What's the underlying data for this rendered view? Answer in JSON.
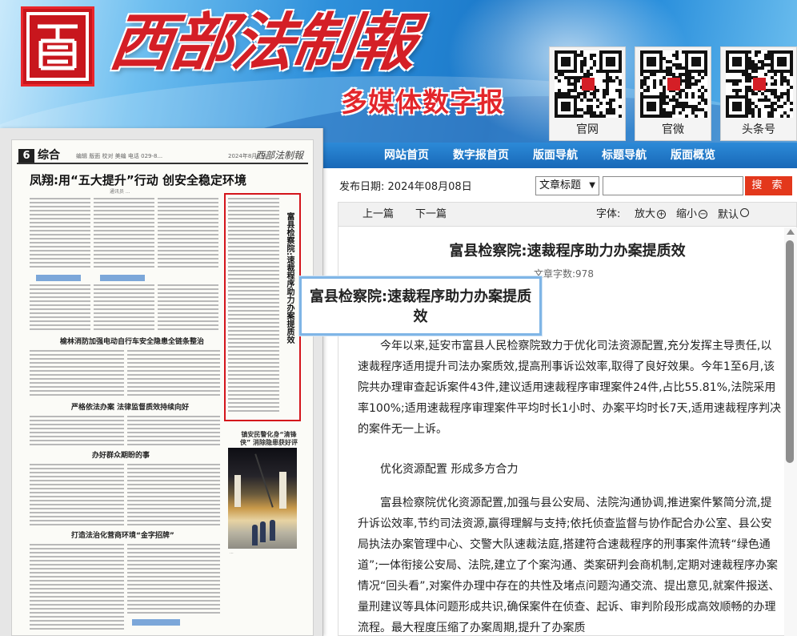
{
  "banner": {
    "paper_name": "西部法制報",
    "subtitle": "多媒体数字报",
    "qr_codes": [
      {
        "label": "官网",
        "icon": "qr-code-icon"
      },
      {
        "label": "官微",
        "icon": "qr-code-icon"
      },
      {
        "label": "头条号",
        "icon": "qr-code-icon"
      }
    ]
  },
  "nav": {
    "items": [
      "网站首页",
      "数字报首页",
      "版面导航",
      "标题导航",
      "版面概览"
    ]
  },
  "page_thumb": {
    "page_number": "6",
    "section": "综合",
    "meta": "编辑 版面 校对 美编 电话 029-8...",
    "date": "2024年8月8日",
    "logo": "西部法制報",
    "headline": "凤翔:用“五大提升”行动 创安全稳定环境",
    "byline": "通讯员 ...",
    "subheads": [
      "榆林消防加强电动自行车安全隐患全链条整治",
      "严格依法办案 法律监督质效持续向好",
      "办好群众期盼的事",
      "打造法治化营商环境“金字招牌”"
    ],
    "highlight_title": "富县检察院:速裁程序助力办案提质效",
    "photo_caption": "镇安民警化身“清锋侠” 消除隐患获好评",
    "photo_credit": "..."
  },
  "search": {
    "pub_date_label": "发布日期:",
    "pub_date": "2024年08月08日",
    "select_value": "文章标题",
    "input_value": "",
    "button_label": "搜 索"
  },
  "toolbar": {
    "prev": "上一篇",
    "next": "下一篇",
    "font_label": "字体:",
    "zoom_in": "放大",
    "zoom_out": "缩小",
    "default": "默认"
  },
  "article": {
    "title": "富县检察院:速裁程序助力办案提质效",
    "word_count": "文章字数:978",
    "paragraphs": [
      "今年以来,延安市富县人民检察院致力于优化司法资源配置,充分发挥主导责任,以速裁程序适用提升司法办案质效,提高刑事诉讼效率,取得了良好效果。今年1至6月,该院共办理审查起诉案件43件,建议适用速裁程序审理案件24件,占比55.81%,法院采用率100%;适用速裁程序审理案件平均时长1小时、办案平均时长7天,适用速裁程序判决的案件无一上诉。",
      "优化资源配置  形成多方合力",
      "富县检察院优化资源配置,加强与县公安局、法院沟通协调,推进案件繁简分流,提升诉讼效率,节约司法资源,赢得理解与支持;依托侦查监督与协作配合办公室、县公安局执法办案管理中心、交警大队速裁法庭,搭建符合速裁程序的刑事案件流转“绿色通道”;一体衔接公安局、法院,建立了个案沟通、类案研判会商机制,定期对速裁程序办案情况“回头看”,对案件办理中存在的共性及堵点问题沟通交流、提出意见,就案件报送、量刑建议等具体问题形成共识,确保案件在侦查、起诉、审判阶段形成高效顺畅的办理流程。最大程度压缩了办案周期,提升了办案质"
    ]
  },
  "tooltip": {
    "text": "富县检察院:速裁程序助力办案提质效"
  },
  "colors": {
    "nav_bg": "#1f74c4",
    "search_button": "#e3381c",
    "highlight_border": "#d4141b",
    "tooltip_border": "#7fb5e6",
    "brand_red": "#d41f26"
  }
}
